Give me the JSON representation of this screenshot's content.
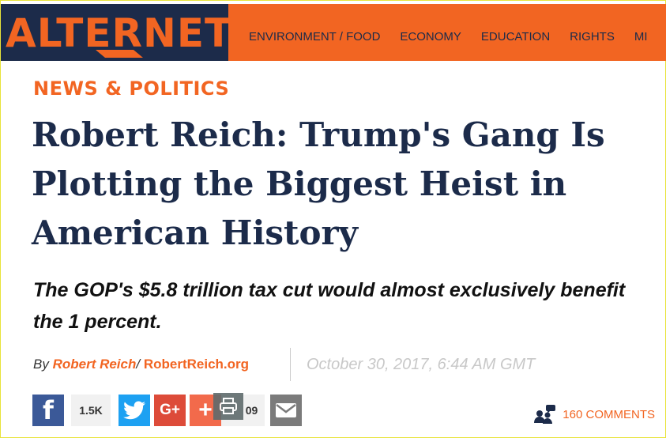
{
  "header": {
    "logo_text": "ALTERNET",
    "nav": [
      "ENVIRONMENT / FOOD",
      "ECONOMY",
      "EDUCATION",
      "RIGHTS",
      "MI"
    ]
  },
  "article": {
    "section": "NEWS & POLITICS",
    "title": "Robert Reich: Trump's Gang Is Plotting the Biggest Heist in American History",
    "dek": "The GOP's $5.8 trillion tax cut would almost exclusively benefit the 1 percent.",
    "byline_prefix": "By",
    "author": "Robert Reich",
    "separator": "/",
    "source": "RobertReich.org",
    "date": "October 30, 2017, 6:44 AM GMT"
  },
  "share": {
    "facebook_glyph": "f",
    "facebook_count": "1.5K",
    "google_glyph": "G+",
    "plus_glyph": "+",
    "plus_count": "09",
    "icons": [
      "facebook-icon",
      "twitter-icon",
      "google-plus-icon",
      "share-plus-icon",
      "print-icon",
      "mail-icon"
    ]
  },
  "comments": {
    "label": "160 COMMENTS",
    "icon": "comments-people-icon"
  },
  "colors": {
    "brand_orange": "#f26522",
    "navy": "#1c2b4a",
    "facebook": "#3b5998",
    "twitter": "#1da1f2",
    "google": "#dd4b39"
  }
}
